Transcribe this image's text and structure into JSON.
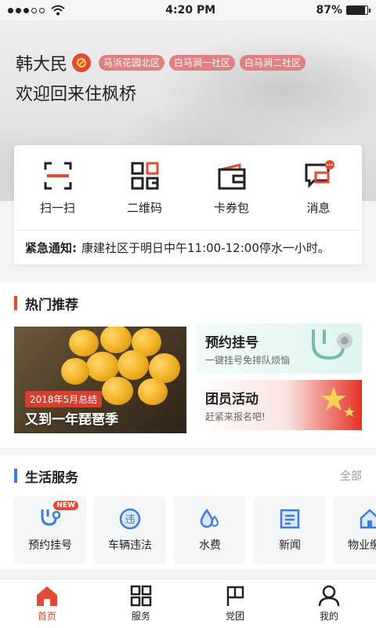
{
  "status_bar": {
    "time": "4:20 PM",
    "battery": "87%",
    "battery_level": 0.87
  },
  "header": {
    "user_name": "韩大民",
    "communities": [
      "马浜花园北区",
      "白马涧一社区",
      "白马涧二社区"
    ],
    "welcome": "欢迎回来住枫桥"
  },
  "quick_actions": [
    {
      "label": "扫一扫",
      "icon": "scan-icon"
    },
    {
      "label": "二维码",
      "icon": "qrcode-icon"
    },
    {
      "label": "卡券包",
      "icon": "wallet-icon"
    },
    {
      "label": "消息",
      "icon": "message-icon"
    }
  ],
  "notice": {
    "label": "紧急通知:",
    "text": "康建社区于明日中午11:00-12:00停水一小时。"
  },
  "hot": {
    "title": "热门推荐",
    "feature": {
      "date": "2018年5月总结",
      "title": "又到一年琵琶季"
    },
    "promos": [
      {
        "title": "预约挂号",
        "subtitle": "一键挂号免排队烦恼"
      },
      {
        "title": "团员活动",
        "subtitle": "赶紧来报名吧!"
      }
    ]
  },
  "life": {
    "title": "生活服务",
    "more": "全部",
    "items": [
      {
        "label": "预约挂号",
        "icon": "stethoscope-icon",
        "badge": "NEW"
      },
      {
        "label": "车辆违法",
        "icon": "violation-icon"
      },
      {
        "label": "水费",
        "icon": "water-drop-icon"
      },
      {
        "label": "新闻",
        "icon": "news-icon"
      },
      {
        "label": "物业缴费",
        "icon": "property-icon"
      }
    ]
  },
  "tabbar": [
    {
      "label": "首页",
      "icon": "home-icon",
      "active": true
    },
    {
      "label": "服务",
      "icon": "grid-icon"
    },
    {
      "label": "党团",
      "icon": "flag-icon"
    },
    {
      "label": "我的",
      "icon": "user-icon"
    }
  ],
  "colors": {
    "accent": "#e24a35",
    "blue": "#3d7be0",
    "tag": "#e08080"
  }
}
